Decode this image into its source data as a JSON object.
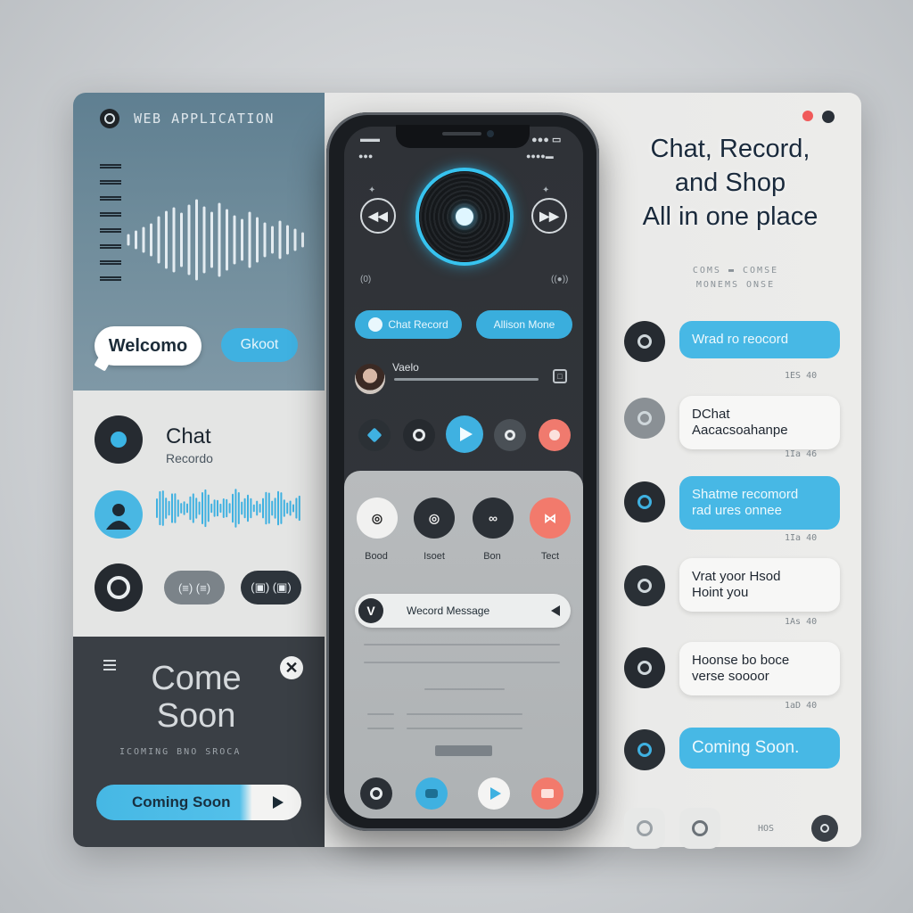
{
  "app": {
    "label": "WEB APPLICATION"
  },
  "left": {
    "welcome_bubble": "Welcomo",
    "blue_pill": "Gkoot",
    "chat_title": "Chat",
    "chat_subtitle": "Recordo",
    "mini_btn_1": "(≡) (≡)",
    "mini_btn_2": "(▣) (▣)",
    "coming_title_1": "Come",
    "coming_title_2": "Soon",
    "coming_caption": "ICOMING BNO SROCA",
    "coming_pill": "Coming Soon"
  },
  "phone": {
    "status_left": "▬▬",
    "status_right": "●●● ▭",
    "status_left2": "●●●",
    "status_right2": "●●●●▬",
    "left_small": "(0)",
    "right_small": "((●))",
    "pill_1": "Chat Record",
    "pill_2": "Allison Mone",
    "track_title": "Vaelo",
    "sheet_labels": [
      "Bood",
      "Isoet",
      "Bon",
      "Tect"
    ],
    "message_pill": "Wecord Message"
  },
  "right": {
    "headline_1": "Chat, Record,",
    "headline_2": "and Shop",
    "headline_3": "All in one place",
    "sub_caption": "COMS ▬ COMSE\nMONEMS ONSE",
    "bubbles": [
      {
        "text": "Wrad ro reocord",
        "style": "blue",
        "time": "1ES 40"
      },
      {
        "text": "DChat\nAacacsoahanpe",
        "style": "white",
        "time": "1Ia 46"
      },
      {
        "text": "Shatme recomord\nrad ures onnee",
        "style": "blue",
        "time": "1Ia 40"
      },
      {
        "text": "Vrat yoor Hsod\nHoint you",
        "style": "white",
        "time": "1As 40"
      },
      {
        "text": "Hoonse bo boce\nverse soooor",
        "style": "white",
        "time": "1aD 40"
      },
      {
        "text": "Coming Soon.",
        "style": "blue",
        "time": ""
      }
    ],
    "bottom_caption": "HOS"
  },
  "colors": {
    "accent": "#3fb1e1",
    "dark": "#2a2f35",
    "coral": "#f26f62"
  }
}
